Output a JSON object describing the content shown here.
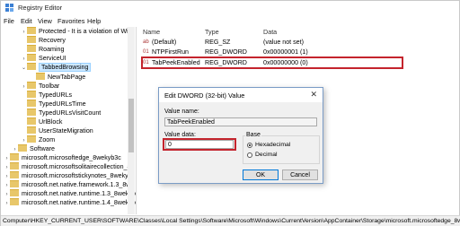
{
  "window": {
    "title": "Registry Editor"
  },
  "menu": [
    "File",
    "Edit",
    "View",
    "Favorites",
    "Help"
  ],
  "tree": [
    {
      "label": "Protected - It is a violation of Wir",
      "expander": "›"
    },
    {
      "label": "Recovery",
      "expander": ""
    },
    {
      "label": "Roaming",
      "expander": ""
    },
    {
      "label": "ServiceUI",
      "expander": "›"
    },
    {
      "label": "TabbedBrowsing",
      "expander": "⌄",
      "selected": true
    },
    {
      "label": "NewTabPage",
      "expander": ""
    },
    {
      "label": "Toolbar",
      "expander": "›"
    },
    {
      "label": "TypedURLs",
      "expander": ""
    },
    {
      "label": "TypedURLsTime",
      "expander": ""
    },
    {
      "label": "TypedURLsVisitCount",
      "expander": ""
    },
    {
      "label": "UrlBlock",
      "expander": ""
    },
    {
      "label": "UserStateMigration",
      "expander": ""
    },
    {
      "label": "Zoom",
      "expander": "›"
    },
    {
      "label": "Software",
      "expander": "›"
    },
    {
      "label": "microsoft.microsoftedge_8wekyb3c",
      "expander": "›"
    },
    {
      "label": "microsoft.microsoftsolitairecollection_8",
      "expander": "›"
    },
    {
      "label": "microsoft.microsoftstickynotes_8wekyb",
      "expander": "›"
    },
    {
      "label": "microsoft.net.native.framework.1.3_8we",
      "expander": "›"
    },
    {
      "label": "microsoft.net.native.runtime.1.3_8wekyb",
      "expander": "›"
    },
    {
      "label": "microsoft.net.native.runtime.1.4_8wekyb",
      "expander": "›"
    }
  ],
  "columns": {
    "name": "Name",
    "type": "Type",
    "data": "Data"
  },
  "values": [
    {
      "icon": "ab",
      "name": "(Default)",
      "type": "REG_SZ",
      "data": "(value not set)"
    },
    {
      "icon": "01",
      "name": "NTPFirstRun",
      "type": "REG_DWORD",
      "data": "0x00000001 (1)"
    },
    {
      "icon": "01",
      "name": "TabPeekEnabled",
      "type": "REG_DWORD",
      "data": "0x00000000 (0)"
    }
  ],
  "dialog": {
    "title": "Edit DWORD (32-bit) Value",
    "close": "✕",
    "value_name_label": "Value name:",
    "value_name": "TabPeekEnabled",
    "value_data_label": "Value data:",
    "value_data": "0",
    "base_label": "Base",
    "hex_label": "Hexadecimal",
    "dec_label": "Decimal",
    "ok": "OK",
    "cancel": "Cancel"
  },
  "status": "Computer\\HKEY_CURRENT_USER\\SOFTWARE\\Classes\\Local Settings\\Software\\Microsoft\\Windows\\CurrentVersion\\AppContainer\\Storage\\microsoft.microsoftedge_8wek"
}
